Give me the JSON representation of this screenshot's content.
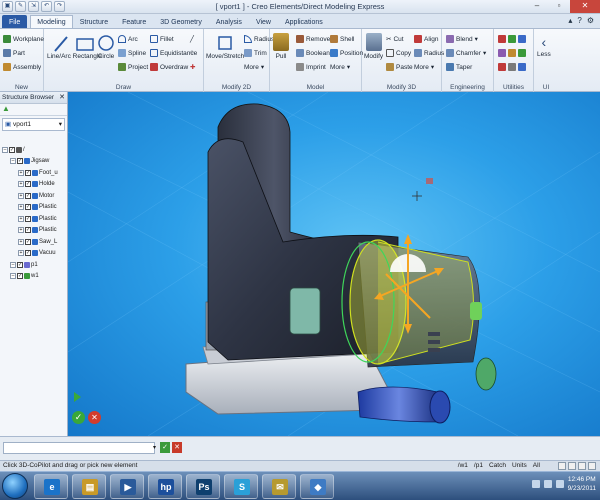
{
  "window": {
    "title": "[ vport1 ] - Creo Elements/Direct Modeling Express"
  },
  "qat": [
    "▣",
    "✎",
    "⇲",
    "↶",
    "↷"
  ],
  "tabs": [
    {
      "label": "File"
    },
    {
      "label": "Modeling"
    },
    {
      "label": "Structure"
    },
    {
      "label": "Feature"
    },
    {
      "label": "3D Geometry"
    },
    {
      "label": "Analysis"
    },
    {
      "label": "View"
    },
    {
      "label": "Applications"
    }
  ],
  "ribbon": {
    "new": {
      "label": "New",
      "workplane": "Workplane",
      "part": "Part",
      "assembly": "Assembly"
    },
    "draw": {
      "label": "Draw",
      "line_arc_rect": "Line/Arc Rectangle",
      "circle": "Circle",
      "arc": "Arc",
      "spline": "Spline",
      "project": "Project",
      "fillet": "Fillet",
      "equidistance": "Equidistance",
      "overdraw": "Overdraw"
    },
    "modify2d": {
      "label": "Modify 2D",
      "move_stretch": "Move/Stretch",
      "radius": "Radius",
      "trim": "Trim",
      "more": "More"
    },
    "model": {
      "label": "Model",
      "pull": "Pull",
      "remove": "Remove",
      "boolean": "Boolean",
      "imprint": "Imprint",
      "shell": "Shell",
      "position": "Position",
      "more": "More"
    },
    "modify3d": {
      "label": "Modify 3D",
      "modify": "Modify",
      "cut": "Cut",
      "copy": "Copy",
      "paste": "Paste",
      "align": "Align",
      "radius": "Radius",
      "more": "More"
    },
    "engineering": {
      "label": "Engineering",
      "blend": "Blend",
      "chamfer": "Chamfer",
      "taper": "Taper"
    },
    "utilities": {
      "label": "Utilities"
    },
    "ui": {
      "label": "UI",
      "less": "Less"
    }
  },
  "browser": {
    "title": "Structure Browser",
    "search_value": "vport1",
    "tree": [
      {
        "label": "/",
        "level": 0
      },
      {
        "label": "Jigsaw",
        "level": 1
      },
      {
        "label": "Foot_u",
        "level": 2
      },
      {
        "label": "Holde",
        "level": 2
      },
      {
        "label": "Motor",
        "level": 2
      },
      {
        "label": "Plastic",
        "level": 2
      },
      {
        "label": "Plastic",
        "level": 2
      },
      {
        "label": "Plastic",
        "level": 2
      },
      {
        "label": "Saw_L",
        "level": 2
      },
      {
        "label": "Vacuu",
        "level": 2
      },
      {
        "label": "p1",
        "level": 1
      },
      {
        "label": "w1",
        "level": 1
      }
    ]
  },
  "statusbar": {
    "message": "Click 3D-CoPilot and drag or pick new element",
    "workplane": "/w1",
    "part": "/p1",
    "catch": "Catch",
    "units": "Units",
    "units_value": "All"
  },
  "taskbar": {
    "time": "12:46 PM",
    "date": "9/23/2011",
    "apps": [
      {
        "glyph": "e",
        "color": "#1a73c9"
      },
      {
        "glyph": "▤",
        "color": "#c89a28"
      },
      {
        "glyph": "▶",
        "color": "#2a5a9a"
      },
      {
        "glyph": "hp",
        "color": "#1c4f9c"
      },
      {
        "glyph": "Ps",
        "color": "#0e3f6e"
      },
      {
        "glyph": "S",
        "color": "#2aa0d8"
      },
      {
        "glyph": "✉",
        "color": "#b69a30"
      },
      {
        "glyph": "◆",
        "color": "#3e7bc4"
      }
    ]
  },
  "colors": {
    "accent": "#2a5aa5",
    "viewport": "#2c9fe8",
    "selection": "#f5a623",
    "highlight": "#d8f03a"
  }
}
